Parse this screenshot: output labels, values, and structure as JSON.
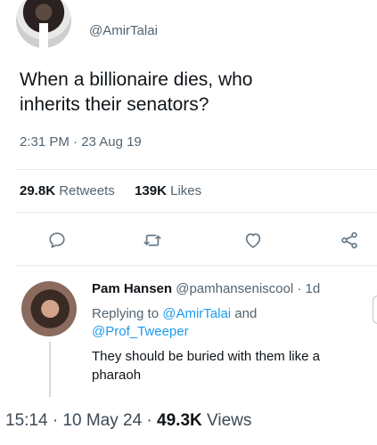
{
  "tweet": {
    "handle": "@AmirTalai",
    "text_line1": "When a billionaire dies, who",
    "text_line2": "inherits their senators?",
    "timestamp": "2:31 PM · 23 Aug 19",
    "retweets_count": "29.8K",
    "retweets_label": "Retweets",
    "likes_count": "139K",
    "likes_label": "Likes"
  },
  "actions": {
    "reply_icon": "speech-bubble-icon",
    "retweet_icon": "retweet-icon",
    "like_icon": "heart-icon",
    "share_icon": "share-icon",
    "icon_color": "#657786"
  },
  "reply": {
    "name": "Pam Hansen",
    "handle": "@pamhanseniscool",
    "age": "· 1d",
    "replying_to_prefix": "Replying to",
    "mention_1": "@AmirTalai",
    "and": "and",
    "mention_2": "@Prof_Tweeper",
    "text_line1": "They should be buried with them like a",
    "text_line2": "pharaoh"
  },
  "caption": {
    "time": "15:14 · 10 May 24 ·",
    "views_count": "49.3K",
    "views_label": "Views"
  },
  "colors": {
    "link": "#1d9bf0",
    "secondary_text": "#536471"
  }
}
